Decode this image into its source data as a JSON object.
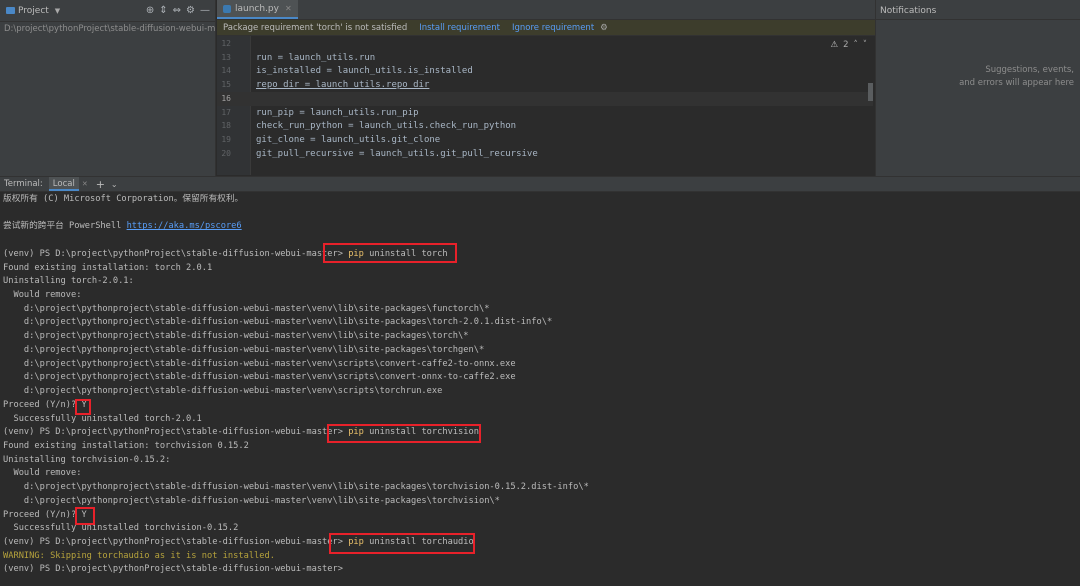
{
  "project": {
    "title": "Project",
    "path": "D:\\project\\pythonProject\\stable-diffusion-webui-master",
    "tools": [
      "⊕",
      "⇕",
      "⇔",
      "⚙",
      "—"
    ]
  },
  "editor": {
    "tab": "launch.py",
    "banner": {
      "message": "Package requirement 'torch' is not satisfied",
      "install": "Install requirement",
      "ignore": "Ignore requirement"
    },
    "warnings": "2",
    "lines": [
      {
        "num": "12",
        "text": ""
      },
      {
        "num": "13",
        "text": "run = launch_utils.run"
      },
      {
        "num": "14",
        "text": "is_installed = launch_utils.is_installed"
      },
      {
        "num": "15",
        "text": "repo_dir = launch_utils.repo_dir"
      },
      {
        "num": "16",
        "text": ""
      },
      {
        "num": "17",
        "text": "run_pip = launch_utils.run_pip"
      },
      {
        "num": "18",
        "text": "check_run_python = launch_utils.check_run_python"
      },
      {
        "num": "19",
        "text": "git_clone = launch_utils.git_clone"
      },
      {
        "num": "20",
        "text": "git_pull_recursive = launch_utils.git_pull_recursive"
      }
    ]
  },
  "notifications": {
    "title": "Notifications",
    "msg1": "Suggestions, events,",
    "msg2": "and errors will appear here"
  },
  "terminal": {
    "label": "Terminal:",
    "tab": "Local",
    "lines": [
      {
        "text": "版权所有 (C) Microsoft Corporation。保留所有权利。"
      },
      {
        "text": ""
      },
      {
        "text": "尝试新的跨平台 PowerShell ",
        "link": "https://aka.ms/pscore6"
      },
      {
        "text": ""
      },
      {
        "text": "(venv) PS D:\\project\\pythonProject\\stable-diffusion-webui-master> ",
        "cmd": "pip",
        "rest": " uninstall torch"
      },
      {
        "text": "Found existing installation: torch 2.0.1"
      },
      {
        "text": "Uninstalling torch-2.0.1:"
      },
      {
        "text": "  Would remove:"
      },
      {
        "text": "    d:\\project\\pythonproject\\stable-diffusion-webui-master\\venv\\lib\\site-packages\\functorch\\*"
      },
      {
        "text": "    d:\\project\\pythonproject\\stable-diffusion-webui-master\\venv\\lib\\site-packages\\torch-2.0.1.dist-info\\*"
      },
      {
        "text": "    d:\\project\\pythonproject\\stable-diffusion-webui-master\\venv\\lib\\site-packages\\torch\\*"
      },
      {
        "text": "    d:\\project\\pythonproject\\stable-diffusion-webui-master\\venv\\lib\\site-packages\\torchgen\\*"
      },
      {
        "text": "    d:\\project\\pythonproject\\stable-diffusion-webui-master\\venv\\scripts\\convert-caffe2-to-onnx.exe"
      },
      {
        "text": "    d:\\project\\pythonproject\\stable-diffusion-webui-master\\venv\\scripts\\convert-onnx-to-caffe2.exe"
      },
      {
        "text": "    d:\\project\\pythonproject\\stable-diffusion-webui-master\\venv\\scripts\\torchrun.exe"
      },
      {
        "text": "Proceed (Y/n)? ",
        "rest": "Y"
      },
      {
        "text": "  Successfully uninstalled torch-2.0.1"
      },
      {
        "text": "(venv) PS D:\\project\\pythonProject\\stable-diffusion-webui-master> ",
        "cmd": "pip",
        "rest": " uninstall torchvision"
      },
      {
        "text": "Found existing installation: torchvision 0.15.2"
      },
      {
        "text": "Uninstalling torchvision-0.15.2:"
      },
      {
        "text": "  Would remove:"
      },
      {
        "text": "    d:\\project\\pythonproject\\stable-diffusion-webui-master\\venv\\lib\\site-packages\\torchvision-0.15.2.dist-info\\*"
      },
      {
        "text": "    d:\\project\\pythonproject\\stable-diffusion-webui-master\\venv\\lib\\site-packages\\torchvision\\*"
      },
      {
        "text": "Proceed (Y/n)? ",
        "rest": "Y"
      },
      {
        "text": "  Successfully uninstalled torchvision-0.15.2"
      },
      {
        "text": "(venv) PS D:\\project\\pythonProject\\stable-diffusion-webui-master> ",
        "cmd": "pip",
        "rest": " uninstall torchaudio"
      },
      {
        "text": "WARNING: Skipping torchaudio as it is not installed.",
        "warn": true
      },
      {
        "text": "(venv) PS D:\\project\\pythonProject\\stable-diffusion-webui-master>"
      }
    ]
  },
  "colors": {
    "highlight_box": "#e8212a",
    "command": "#e8bf6a",
    "warning": "#b5a23c",
    "link": "#589df6"
  }
}
